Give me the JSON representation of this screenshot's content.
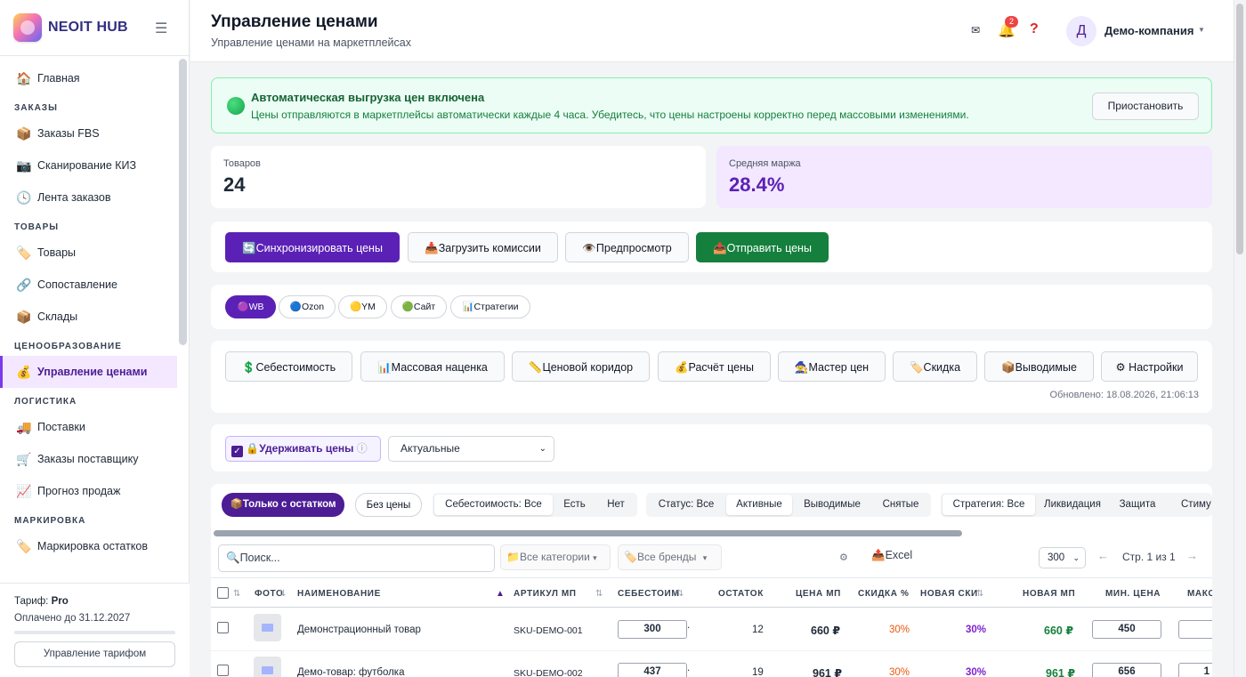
{
  "brand": {
    "name": "NEOIT HUB"
  },
  "sidebar": {
    "home": {
      "icon": "🏠",
      "label": "Главная"
    },
    "sections": {
      "orders": "ЗАКАЗЫ",
      "goods": "ТОВАРЫ",
      "pricing": "ЦЕНООБРАЗОВАНИЕ",
      "logistics": "ЛОГИСТИКА",
      "marking": "МАРКИРОВКА"
    },
    "orders_items": [
      {
        "icon": "📦",
        "label": "Заказы FBS"
      },
      {
        "icon": "📷",
        "label": "Сканирование КИЗ"
      },
      {
        "icon": "🕓",
        "label": "Лента заказов"
      }
    ],
    "goods_items": [
      {
        "icon": "🏷️",
        "label": "Товары"
      },
      {
        "icon": "🔗",
        "label": "Сопоставление"
      },
      {
        "icon": "📦",
        "label": "Склады"
      }
    ],
    "pricing_items": [
      {
        "icon": "💰",
        "label": "Управление ценами"
      }
    ],
    "logistics_items": [
      {
        "icon": "🚚",
        "label": "Поставки"
      },
      {
        "icon": "🛒",
        "label": "Заказы поставщику"
      },
      {
        "icon": "📈",
        "label": "Прогноз продаж"
      }
    ],
    "marking_items": [
      {
        "icon": "🏷️",
        "label": "Маркировка остатков"
      }
    ],
    "plan": {
      "tariff_label": "Тариф:",
      "tariff_value": "Pro",
      "paid_until": "Оплачено до 31.12.2027",
      "manage_button": "Управление тарифом"
    }
  },
  "header": {
    "title": "Управление ценами",
    "subtitle": "Управление ценами на маркетплейсах",
    "notifications_count": "2",
    "avatar_letter": "Д",
    "company": "Демо-компания"
  },
  "banner": {
    "title": "Автоматическая выгрузка цен включена",
    "text": "Цены отправляются в маркетплейсы автоматически каждые 4 часа. Убедитесь, что цены настроены корректно перед массовыми изменениями.",
    "button": "Приостановить"
  },
  "stats": {
    "products_label": "Товаров",
    "products_value": "24",
    "margin_label": "Средняя маржа",
    "margin_value": "28.4%"
  },
  "actions": {
    "sync": "🔄Синхронизировать цены",
    "load_commissions": "📥Загрузить комиссии",
    "preview": "👁️Предпросмотр",
    "send": "📤Отправить цены"
  },
  "marketplaces": {
    "wb": "🟣WB",
    "ozon": "🔵Ozon",
    "ym": "🟡YM",
    "site": "🟢Сайт",
    "strategies": "📊Стратегии"
  },
  "tools": {
    "cost": "💲Себестоимость",
    "markup": "📊Массовая наценка",
    "corridor": "📏Ценовой коридор",
    "calc": "💰Расчёт цены",
    "wizard": "🧙Мастер цен",
    "discount": "🏷️Скидка",
    "withdrawn": "📦Выводимые",
    "settings": "⚙ Настройки",
    "updated": "Обновлено: 18.08.2026, 21:06:13"
  },
  "hold": {
    "label": "🔒Удерживать цены",
    "info": "ⓘ",
    "status_value": "Актуальные"
  },
  "filters": {
    "only_stock": "📦Только с остатком",
    "no_price": "Без цены",
    "cost_group": [
      "Себестоимость: Все",
      "Есть",
      "Нет"
    ],
    "status_group": [
      "Статус: Все",
      "Активные",
      "Выводимые",
      "Снятые"
    ],
    "strategy_group": [
      "Стратегия: Все",
      "Ликвидация",
      "Защита",
      "Стиму"
    ],
    "search_placeholder": "🔍Поиск...",
    "categories": "📁Все категории",
    "brands": "🏷️Все бренды",
    "excel": "📤Excel",
    "per_page": "300",
    "page_info": "Стр. 1 из 1"
  },
  "table": {
    "columns": [
      "ФОТО",
      "НАИМЕНОВАНИЕ",
      "АРТИКУЛ МП",
      "СЕБЕСТОИМ",
      "ОСТАТОК",
      "ЦЕНА МП",
      "СКИДКА %",
      "НОВАЯ СКИ",
      "НОВАЯ МП",
      "МИН. ЦЕНА",
      "МАКС"
    ],
    "rows": [
      {
        "name": "Демонстрационный товар",
        "sku": "SKU-DEMO-001",
        "cost": "300",
        "stock": "12",
        "price": "660 ₽",
        "discount": "30%",
        "new_discount": "30%",
        "new_price": "660 ₽",
        "min_price": "450",
        "max": ""
      },
      {
        "name": "Демо-товар: футболка",
        "sku": "SKU-DEMO-002",
        "cost": "437",
        "stock": "19",
        "price": "961 ₽",
        "discount": "30%",
        "new_discount": "30%",
        "new_price": "961 ₽",
        "min_price": "656",
        "max": "1"
      }
    ]
  },
  "colors": {
    "accent": "#5b21b6",
    "success": "#15803d",
    "discount": "#ea580c",
    "new_discount": "#7e22ce"
  }
}
